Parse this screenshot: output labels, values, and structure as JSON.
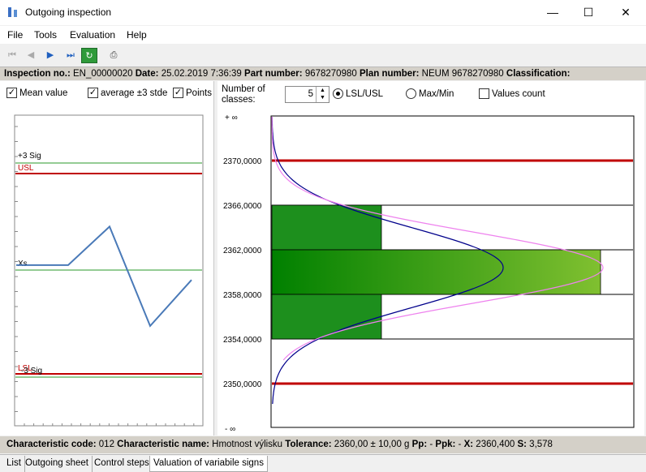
{
  "window": {
    "title": "Outgoing inspection",
    "minimize": "—",
    "maximize": "☐",
    "close": "✕"
  },
  "menu": [
    "File",
    "Tools",
    "Evaluation",
    "Help"
  ],
  "info": {
    "inspection_label": "Inspection no.:",
    "inspection_value": "EN_00000020",
    "date_label": "Date:",
    "date_value": "25.02.2019 7:36:39",
    "part_label": "Part number:",
    "part_value": "9678270980",
    "plan_label": "Plan number:",
    "plan_value": "NEUM 9678270980",
    "class_label": "Classification:"
  },
  "left_options": {
    "mean_value": "Mean value",
    "average": "average ±3 stde",
    "points": "Points"
  },
  "controls": {
    "classes_label_1": "Number of",
    "classes_label_2": "classes:",
    "classes_value": "5",
    "lsl_usl": "LSL/USL",
    "max_min": "Max/Min",
    "values_count": "Values count"
  },
  "control_chart": {
    "labels": {
      "plus3": "+3 Sig",
      "usl": "USL",
      "xs": "Xs",
      "lsl": "LSL",
      "minus3": "-3 Sig"
    },
    "points": [
      2360.4,
      2360.4,
      2363.5,
      2355.5,
      2359.2
    ]
  },
  "chart_data": {
    "type": "bar",
    "orientation": "horizontal",
    "title": "",
    "y_ticks": [
      "2370,0000",
      "2366,0000",
      "2362,0000",
      "2358,0000",
      "2354,0000",
      "2350,0000"
    ],
    "y_extremes": [
      "+ ∞",
      "- ∞"
    ],
    "ylim": [
      2348,
      2372
    ],
    "usl": 2370,
    "lsl": 2350,
    "classes": [
      {
        "from": 2362,
        "to": 2366,
        "count": 1
      },
      {
        "from": 2358,
        "to": 2362,
        "count": 3
      },
      {
        "from": 2354,
        "to": 2358,
        "count": 1
      }
    ],
    "curves": [
      "normal-fit",
      "expected-normal"
    ],
    "colors": {
      "bar_dark": "#008000",
      "bar_light": "#80c030",
      "limit": "#c00000",
      "curve1": "#00008b",
      "curve2": "#ee82ee"
    }
  },
  "status": {
    "code_label": "Characteristic code:",
    "code_value": "012",
    "name_label": "Characteristic name:",
    "name_value": "Hmotnost výlisku",
    "tol_label": "Tolerance:",
    "tol_value": "2360,00 ± 10,00 g",
    "pp_label": "Pp:",
    "pp_value": "-",
    "ppk_label": "Ppk:",
    "ppk_value": "-",
    "x_label": "X:",
    "x_value": "2360,400",
    "s_label": "S:",
    "s_value": "3,578"
  },
  "tabs": [
    "List",
    "Outgoing sheet",
    "Control steps",
    "Valuation of variabile signs"
  ]
}
